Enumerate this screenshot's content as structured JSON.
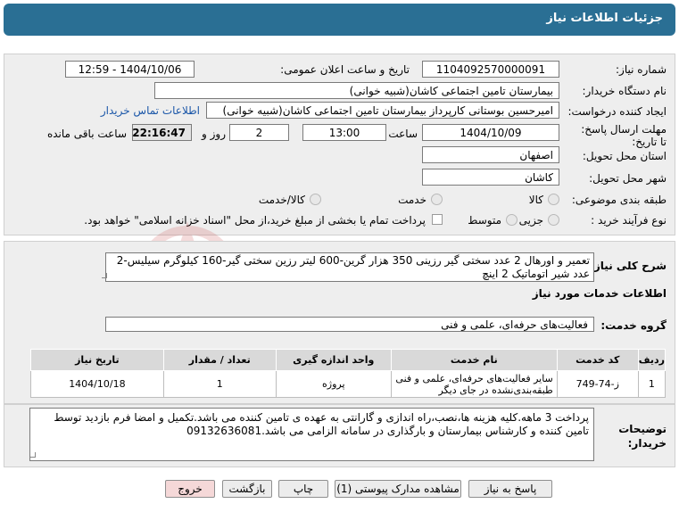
{
  "header": {
    "title": "جزئیات اطلاعات نیاز"
  },
  "form": {
    "need_number_label": "شماره نیاز:",
    "need_number": "1104092570000091",
    "announce_label": "تاریخ و ساعت اعلان عمومی:",
    "announce_value": "1404/10/06 - 12:59",
    "buyer_org_label": "نام دستگاه خریدار:",
    "buyer_org": "بیمارستان تامین اجتماعی کاشان(شبیه خوانی)",
    "creator_label": "ایجاد کننده درخواست:",
    "creator": "امیرحسین بوستانی کارپرداز بیمارستان تامین اجتماعی کاشان(شبیه خوانی)",
    "contact_link": "اطلاعات تماس خریدار",
    "deadline_label": "مهلت ارسال پاسخ: تا تاریخ:",
    "deadline_date": "1404/10/09",
    "time_label": "ساعت",
    "deadline_time": "13:00",
    "days_value": "2",
    "days_label": "روز و",
    "remaining_time": "22:16:47",
    "remaining_label": "ساعت باقی مانده",
    "province_label": "استان محل تحویل:",
    "province": "اصفهان",
    "city_label": "شهر محل تحویل:",
    "city": "کاشان",
    "category_label": "طبقه بندی موضوعی:",
    "category_options": [
      "کالا",
      "خدمت",
      "کالا/خدمت"
    ],
    "purchase_type_label": "نوع فرآیند خرید :",
    "purchase_options": [
      "جزیی",
      "متوسط"
    ],
    "payment_note": "پرداخت تمام یا بخشی از مبلغ خرید،از محل \"اسناد خزانه اسلامی\" خواهد بود."
  },
  "description": {
    "label": "شرح کلی نیاز:",
    "text": "تعمیر و اورهال 2 عدد سختی گیر رزینی 350 هزار گرین-600 لیتر رزین سختی گیر-160 کیلوگرم سیلیس-2 عدد شیر اتوماتیک 2 اینچ"
  },
  "services": {
    "section_title": "اطلاعات خدمات مورد نیاز",
    "group_label": "گروه خدمت:",
    "group_value": "فعالیت‌های حرفه‌ای، علمی و فنی",
    "columns": [
      "ردیف",
      "کد خدمت",
      "نام خدمت",
      "واحد اندازه گیری",
      "تعداد / مقدار",
      "تاریخ نیاز"
    ],
    "rows": [
      {
        "index": "1",
        "code": "ز-74-749",
        "name": "سایر فعالیت‌های حرفه‌ای، علمی و فنی طبقه‌بندی‌نشده در جای دیگر",
        "unit": "پروژه",
        "qty": "1",
        "date": "1404/10/18"
      }
    ]
  },
  "notes": {
    "label": "توضیحات خریدار:",
    "text": "پرداخت 3 ماهه.کلیه هزینه ها،نصب،راه اندازی و گارانتی به عهده ی تامین کننده می باشد.تکمیل و امضا فرم بازدید توسط تامین کننده و کارشناس بیمارستان و بارگذاری در سامانه الزامی می باشد.09132636081"
  },
  "buttons": {
    "reply": "پاسخ به نیاز",
    "view_docs": "مشاهده مدارک پیوستی (1)",
    "print": "چاپ",
    "back": "بازگشت",
    "exit": "خروج"
  },
  "colors": {
    "header_bg": "#2a6f94",
    "link": "#1a56a8"
  }
}
